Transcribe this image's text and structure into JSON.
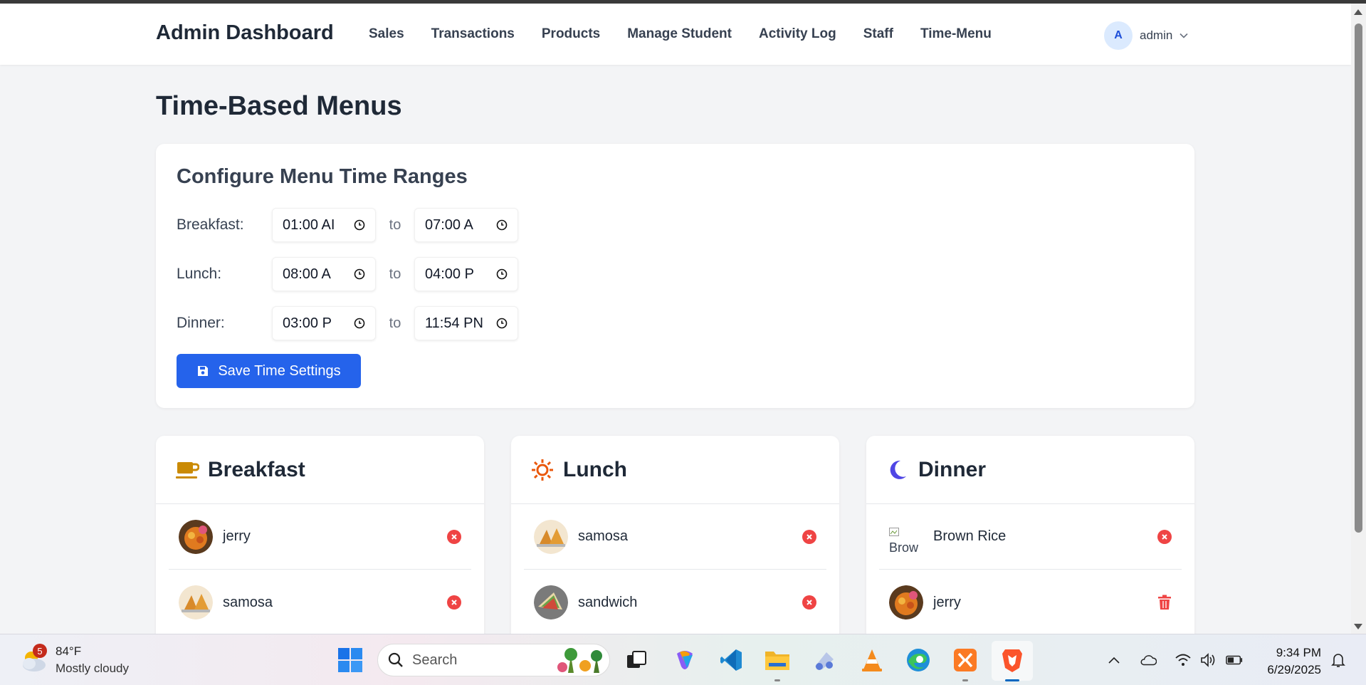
{
  "navbar": {
    "brand": "Admin Dashboard",
    "links": [
      "Sales",
      "Transactions",
      "Products",
      "Manage Student",
      "Activity Log",
      "Staff",
      "Time-Menu"
    ],
    "user_initial": "A",
    "user_name": "admin"
  },
  "page": {
    "title": "Time-Based Menus"
  },
  "config": {
    "title": "Configure Menu Time Ranges",
    "to_label": "to",
    "rows": [
      {
        "label": "Breakfast:",
        "start": "01:00 AI",
        "end": "07:00 A"
      },
      {
        "label": "Lunch:",
        "start": "08:00 A",
        "end": "04:00 P"
      },
      {
        "label": "Dinner:",
        "start": "03:00 P",
        "end": "11:54 PN"
      }
    ],
    "save_label": "Save Time Settings"
  },
  "menus": [
    {
      "title": "Breakfast",
      "icon": "coffee-cup-icon",
      "color": "#ca8a04",
      "items": [
        {
          "name": "jerry",
          "action": "remove"
        },
        {
          "name": "samosa",
          "action": "remove"
        }
      ]
    },
    {
      "title": "Lunch",
      "icon": "sun-icon",
      "color": "#ea580c",
      "items": [
        {
          "name": "samosa",
          "action": "remove"
        },
        {
          "name": "sandwich",
          "action": "remove"
        }
      ]
    },
    {
      "title": "Dinner",
      "icon": "moon-icon",
      "color": "#4f46e5",
      "items": [
        {
          "name": "Brown Rice",
          "alt": "Brow",
          "action": "remove"
        },
        {
          "name": "jerry",
          "action": "delete"
        }
      ]
    }
  ],
  "taskbar": {
    "weather_temp": "84°F",
    "weather_desc": "Mostly cloudy",
    "weather_badge": "5",
    "search_placeholder": "Search",
    "time": "9:34 PM",
    "date": "6/29/2025"
  },
  "colors": {
    "primary": "#2563eb",
    "danger": "#ef4444",
    "background": "#f3f4f6"
  }
}
